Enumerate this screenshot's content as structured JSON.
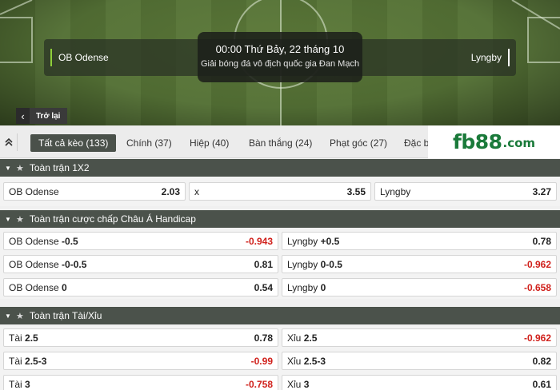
{
  "match": {
    "home": "OB Odense",
    "away": "Lyngby",
    "time": "00:00 Thứ Bảy, 22 tháng 10",
    "league": "Giải bóng đá vô địch quốc gia Đan Mạch",
    "back_label": "Trở lại"
  },
  "tabs": [
    {
      "label": "Tất cả kèo (133)",
      "active": true
    },
    {
      "label": "Chính (37)"
    },
    {
      "label": "Hiệp (40)"
    },
    {
      "label": "Bàn thắng (24)"
    },
    {
      "label": "Phạt góc (27)"
    },
    {
      "label": "Đặc b"
    }
  ],
  "logo": {
    "brand": "fb88",
    "suffix": ".com"
  },
  "sections": [
    {
      "title": "Toàn trận 1X2",
      "rows": [
        [
          {
            "name": "OB Odense",
            "line": "",
            "odd": "2.03"
          },
          {
            "name": "x",
            "line": "",
            "odd": "3.55"
          },
          {
            "name": "Lyngby",
            "line": "",
            "odd": "3.27"
          }
        ]
      ]
    },
    {
      "title": "Toàn trận cược chấp Châu Á Handicap",
      "rows": [
        [
          {
            "name": "OB Odense",
            "line": "-0.5",
            "odd": "-0.943"
          },
          {
            "name": "Lyngby",
            "line": "+0.5",
            "odd": "0.78"
          }
        ],
        [
          {
            "name": "OB Odense",
            "line": "-0-0.5",
            "odd": "0.81"
          },
          {
            "name": "Lyngby",
            "line": "0-0.5",
            "odd": "-0.962"
          }
        ],
        [
          {
            "name": "OB Odense",
            "line": "0",
            "odd": "0.54"
          },
          {
            "name": "Lyngby",
            "line": "0",
            "odd": "-0.658"
          }
        ]
      ]
    },
    {
      "title": "Toàn trận Tài/Xỉu",
      "rows": [
        [
          {
            "name": "Tài",
            "line": "2.5",
            "odd": "0.78"
          },
          {
            "name": "Xỉu",
            "line": "2.5",
            "odd": "-0.962"
          }
        ],
        [
          {
            "name": "Tài",
            "line": "2.5-3",
            "odd": "-0.99"
          },
          {
            "name": "Xỉu",
            "line": "2.5-3",
            "odd": "0.82"
          }
        ],
        [
          {
            "name": "Tài",
            "line": "3",
            "odd": "-0.758"
          },
          {
            "name": "Xỉu",
            "line": "3",
            "odd": "0.61"
          }
        ]
      ]
    }
  ],
  "colors": {
    "negative_odd": "#d0201b",
    "header_bg": "#4b524b",
    "brand": "#1a7a3a"
  }
}
